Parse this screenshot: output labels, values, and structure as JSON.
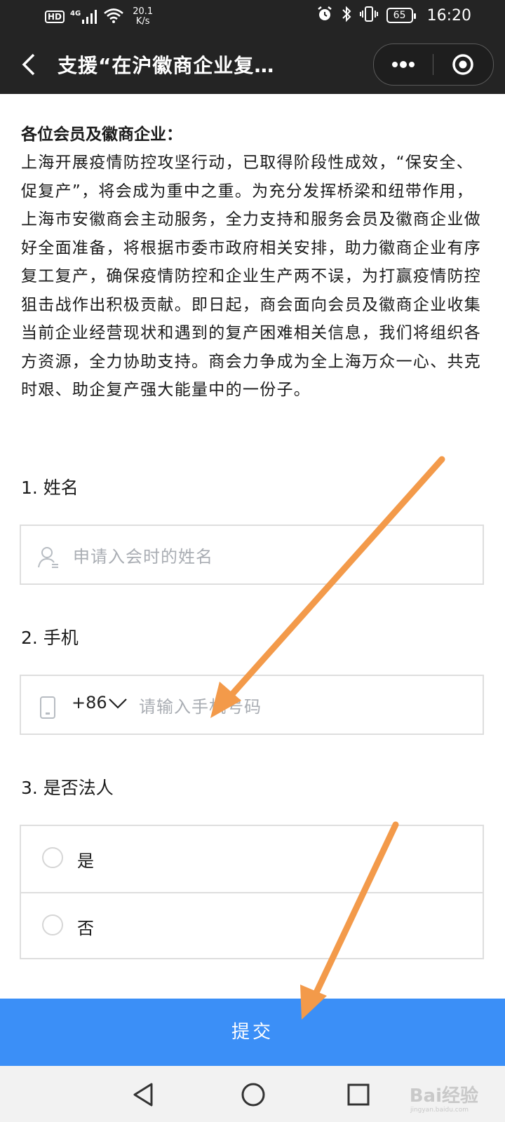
{
  "status_bar": {
    "hd": "HD",
    "signal": "4G",
    "net_speed_value": "20.1",
    "net_speed_unit": "K/s",
    "battery": "65",
    "time": "16:20"
  },
  "titlebar": {
    "title": "支援“在沪徽商企业复…"
  },
  "intro": {
    "heading": "各位会员及徽商企业：",
    "body": "上海开展疫情防控攻坚行动，已取得阶段性成效，“保安全、促复产”，将会成为重中之重。为充分发挥桥梁和纽带作用，上海市安徽商会主动服务，全力支持和服务会员及徽商企业做好全面准备，将根据市委市政府相关安排，助力徽商企业有序复工复产，确保疫情防控和企业生产两不误，为打赢疫情防控狙击战作出积极贡献。即日起，商会面向会员及徽商企业收集当前企业经营现状和遇到的复产困难相关信息，我们将组织各方资源，全力协助支持。商会力争成为全上海万众一心、共克时艰、助企复产强大能量中的一份子。"
  },
  "form": {
    "q1_label": "1. 姓名",
    "name_placeholder": "申请入会时的姓名",
    "q2_label": "2. 手机",
    "country_code": "+86",
    "phone_placeholder": "请输入手机号码",
    "q3_label": "3. 是否法人",
    "options": [
      "是",
      "否"
    ],
    "submit_label": "提交"
  },
  "watermark": {
    "text": "Bai经验",
    "sub": "jingyan.baidu.com"
  },
  "colors": {
    "bar_bg": "#242424",
    "submit_bg": "#3b8ff7",
    "arrow": "#f39a4a",
    "placeholder": "#a9adb3"
  }
}
